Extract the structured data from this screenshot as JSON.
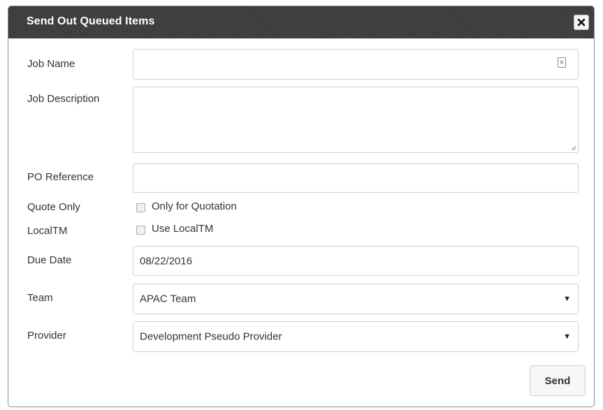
{
  "dialog": {
    "title": "Send Out Queued Items",
    "close_icon": "close-icon"
  },
  "form": {
    "job_name": {
      "label": "Job Name",
      "value": "",
      "icon": "contact-card-icon"
    },
    "job_description": {
      "label": "Job Description",
      "value": ""
    },
    "po_reference": {
      "label": "PO Reference",
      "value": ""
    },
    "quote_only": {
      "label": "Quote Only",
      "checkbox_label": "Only for Quotation",
      "checked": false
    },
    "local_tm": {
      "label": "LocalTM",
      "checkbox_label": "Use LocalTM",
      "checked": false
    },
    "due_date": {
      "label": "Due Date",
      "value": "08/22/2016"
    },
    "team": {
      "label": "Team",
      "selected": "APAC Team"
    },
    "provider": {
      "label": "Provider",
      "selected": "Development Pseudo Provider"
    }
  },
  "actions": {
    "send_label": "Send"
  }
}
